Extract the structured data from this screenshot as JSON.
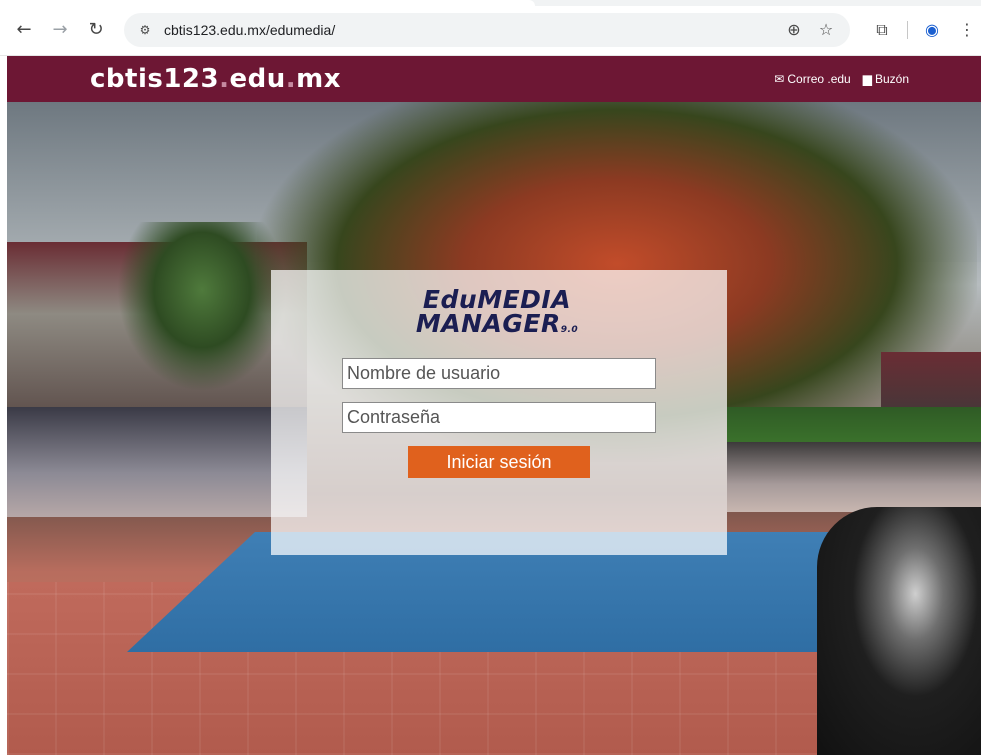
{
  "browser": {
    "url": "cbtis123.edu.mx/edumedia/",
    "icons": {
      "back": "arrow-left-icon",
      "forward": "arrow-right-icon",
      "reload": "reload-icon",
      "site_info": "tune-icon",
      "zoom": "zoom-icon",
      "bookmark": "star-icon",
      "extensions": "puzzle-icon",
      "profile": "profile-icon",
      "menu": "kebab-menu-icon"
    }
  },
  "header": {
    "logo_main": "cbtis123",
    "logo_dot1": ".",
    "logo_edu": "edu",
    "logo_dot2": ".",
    "logo_mx": "mx",
    "links": [
      {
        "label": "Correo .edu",
        "icon": "mail-icon"
      },
      {
        "label": "Buzón",
        "icon": "inbox-icon"
      }
    ],
    "color": "#6d1734"
  },
  "login": {
    "brand_line1": "EduMEDIA",
    "brand_line2": "MANAGER",
    "brand_version": "9.0",
    "username_placeholder": "Nombre de usuario",
    "password_placeholder": "Contraseña",
    "submit_label": "Iniciar sesión",
    "button_color": "#e0611d",
    "brand_color": "#1b1e52"
  }
}
